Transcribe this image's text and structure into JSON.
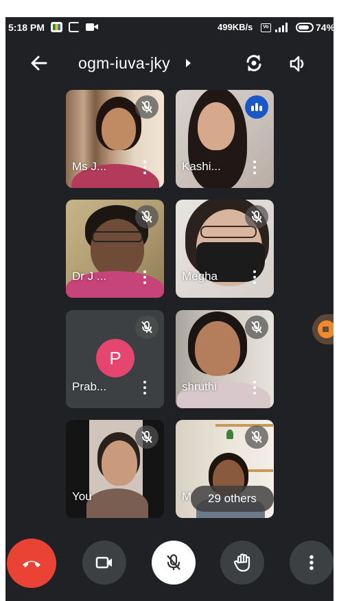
{
  "status_bar": {
    "time": "5:18 PM",
    "speed": "499KB/s",
    "volte": "Vo",
    "battery": "74%",
    "icons": [
      "meet-app-icon",
      "cast-icon",
      "video-icon",
      "volte-icon",
      "signal-icon",
      "battery-icon"
    ]
  },
  "header": {
    "title": "ogm-iuva-jky",
    "icons": [
      "back-arrow-icon",
      "chevron-right-icon",
      "switch-camera-icon",
      "speaker-icon"
    ]
  },
  "participants": [
    {
      "name": "Ms J...",
      "muted": true
    },
    {
      "name": "Kashi...",
      "muted": false,
      "speaking": true
    },
    {
      "name": "Dr J ...",
      "muted": true
    },
    {
      "name": "Megha",
      "muted": true
    },
    {
      "name": "Prab...",
      "muted": true,
      "avatar_letter": "P",
      "avatar_color": "#e5456f"
    },
    {
      "name": "shruthi",
      "muted": true
    },
    {
      "name": "You",
      "muted": true
    },
    {
      "name": "M",
      "muted": true
    }
  ],
  "others_chip": "29 others",
  "controls": {
    "icons": [
      "end-call-icon",
      "camera-icon",
      "mic-off-icon",
      "raise-hand-icon",
      "more-vert-icon"
    ],
    "colors": {
      "end_call": "#ea4335",
      "mic_active_bg": "#ffffff",
      "control_bg": "#3c4043"
    }
  },
  "colors": {
    "background": "#202124",
    "speaking": "#1a57c7"
  }
}
